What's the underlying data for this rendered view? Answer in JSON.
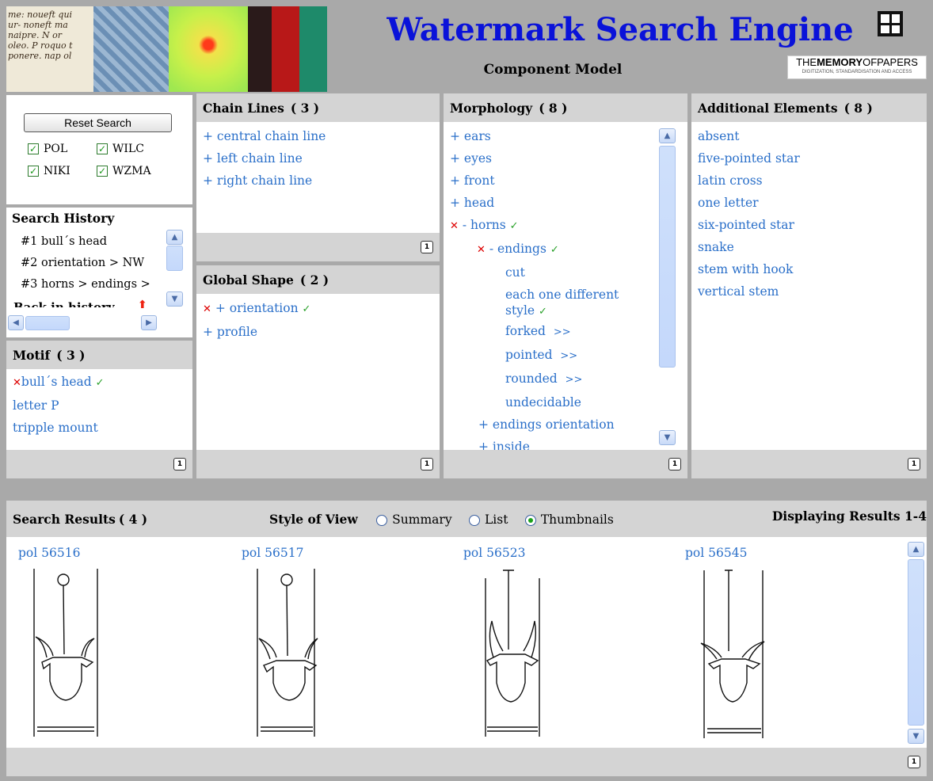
{
  "header": {
    "title": "Watermark Search Engine",
    "subtitle": "Component Model",
    "logo_text_a": "THE",
    "logo_text_b": "MEMORY",
    "logo_text_c": "OFPAPERS",
    "logo_caption": "DIGITIZATION, STANDARDISATION AND ACCESS",
    "manuscript_snippets": [
      "me: noueft qui",
      "ur- noneft ma",
      "naipre. N or",
      "oleo. P roquo t",
      "ponere. nap ol"
    ]
  },
  "filters": {
    "reset_label": "Reset Search",
    "sources": [
      {
        "label": "POL",
        "checked": true
      },
      {
        "label": "WILC",
        "checked": true
      },
      {
        "label": "NIKI",
        "checked": true
      },
      {
        "label": "WZMA",
        "checked": true
      }
    ]
  },
  "history": {
    "title": "Search History",
    "items": [
      "#1 bull´s head",
      "#2 orientation > NW",
      "#3 horns > endings >",
      "Back in history"
    ]
  },
  "motif": {
    "title": "Motif",
    "count": "( 3 )",
    "items": [
      "bull´s head",
      "letter P",
      "tripple mount"
    ]
  },
  "chain_lines": {
    "title": "Chain Lines",
    "count": "( 3 )",
    "items": [
      "+ central chain line",
      "+ left chain line",
      "+ right chain line"
    ]
  },
  "global_shape": {
    "title": "Global Shape",
    "count": "( 2 )",
    "items": [
      "+ orientation",
      "+ profile"
    ]
  },
  "morphology": {
    "title": "Morphology",
    "count": "( 8 )",
    "items": [
      "+ ears",
      "+ eyes",
      "+ front",
      "+ head",
      "- horns",
      "- endings",
      "cut",
      "each one different",
      "style",
      "forked",
      ">>",
      "pointed",
      ">>",
      "rounded",
      ">>",
      "undecidable",
      "+ endings orientation",
      "+ inside"
    ]
  },
  "additional": {
    "title": "Additional Elements",
    "count": "( 8 )",
    "items": [
      "absent",
      "five-pointed star",
      "latin cross",
      "one letter",
      "six-pointed star",
      "snake",
      "stem with hook",
      "vertical stem"
    ]
  },
  "results": {
    "title": "Search Results",
    "count": "( 4 )",
    "style_label": "Style of View",
    "views": [
      "Summary",
      "List",
      "Thumbnails"
    ],
    "selected_view": "Thumbnails",
    "range": "Displaying Results 1-4",
    "items": [
      "pol 56516",
      "pol 56517",
      "pol 56523",
      "pol 56545"
    ]
  },
  "pager": {
    "page": "1"
  },
  "colors": {
    "link": "#2a6fc9",
    "title": "#0a12d9",
    "header_bg": "#d4d4d4",
    "frame": "#a9a9a9"
  }
}
